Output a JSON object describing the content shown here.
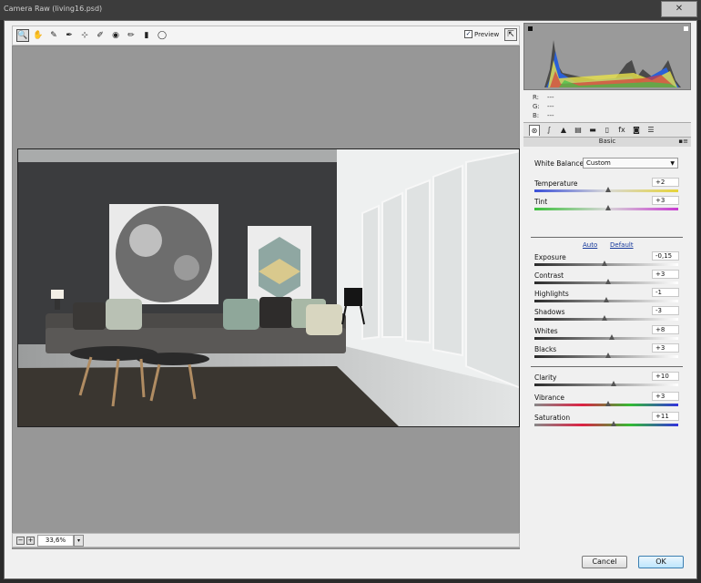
{
  "window": {
    "title": "Camera Raw (living16.psd)",
    "close_glyph": "✕"
  },
  "toolbar": {
    "tools": [
      {
        "name": "zoom-tool-icon",
        "glyph": "🔍"
      },
      {
        "name": "hand-tool-icon",
        "glyph": "✋"
      },
      {
        "name": "white-balance-tool-icon",
        "glyph": "✎"
      },
      {
        "name": "color-sampler-tool-icon",
        "glyph": "✒"
      },
      {
        "name": "targeted-adjustment-tool-icon",
        "glyph": "⊹"
      },
      {
        "name": "spot-removal-tool-icon",
        "glyph": "✐"
      },
      {
        "name": "red-eye-tool-icon",
        "glyph": "◉"
      },
      {
        "name": "adjustment-brush-icon",
        "glyph": "✏"
      },
      {
        "name": "graduated-filter-icon",
        "glyph": "▮"
      },
      {
        "name": "radial-filter-icon",
        "glyph": "◯"
      }
    ],
    "preview_label": "Preview",
    "preview_check": "✓",
    "fullscreen_glyph": "⇱"
  },
  "status": {
    "zoom_value": "33,6%",
    "zoom_minus": "−",
    "zoom_plus": "+",
    "dropdown_glyph": "▾"
  },
  "histogram": {
    "r_label": "R:",
    "g_label": "G:",
    "b_label": "B:",
    "r_value": "---",
    "g_value": "---",
    "b_value": "---"
  },
  "panel_tabs": [
    {
      "name": "basic-tab-icon",
      "glyph": "⊛"
    },
    {
      "name": "tone-curve-tab-icon",
      "glyph": "∫"
    },
    {
      "name": "detail-tab-icon",
      "glyph": "▲"
    },
    {
      "name": "hsl-tab-icon",
      "glyph": "▤"
    },
    {
      "name": "split-toning-tab-icon",
      "glyph": "▬"
    },
    {
      "name": "lens-corrections-tab-icon",
      "glyph": "▯"
    },
    {
      "name": "effects-tab-icon",
      "glyph": "fx"
    },
    {
      "name": "camera-calibration-tab-icon",
      "glyph": "◙"
    },
    {
      "name": "presets-tab-icon",
      "glyph": "☰"
    }
  ],
  "basic": {
    "title": "Basic",
    "menu_glyph": "▪≡",
    "white_balance_label": "White Balance:",
    "white_balance_value": "Custom",
    "auto_label": "Auto",
    "default_label": "Default",
    "sliders": [
      {
        "label": "Temperature",
        "value": "+2",
        "pos": 0.51
      },
      {
        "label": "Tint",
        "value": "+3",
        "pos": 0.51
      },
      {
        "label": "Exposure",
        "value": "-0,15",
        "pos": 0.49
      },
      {
        "label": "Contrast",
        "value": "+3",
        "pos": 0.51
      },
      {
        "label": "Highlights",
        "value": "-1",
        "pos": 0.5
      },
      {
        "label": "Shadows",
        "value": "-3",
        "pos": 0.49
      },
      {
        "label": "Whites",
        "value": "+8",
        "pos": 0.54
      },
      {
        "label": "Blacks",
        "value": "+3",
        "pos": 0.51
      },
      {
        "label": "Clarity",
        "value": "+10",
        "pos": 0.55
      },
      {
        "label": "Vibrance",
        "value": "+3",
        "pos": 0.51
      },
      {
        "label": "Saturation",
        "value": "+11",
        "pos": 0.55
      }
    ]
  },
  "buttons": {
    "cancel": "Cancel",
    "ok": "OK"
  },
  "colors": {
    "accent": "#3c7fb1",
    "link": "#14379a"
  }
}
